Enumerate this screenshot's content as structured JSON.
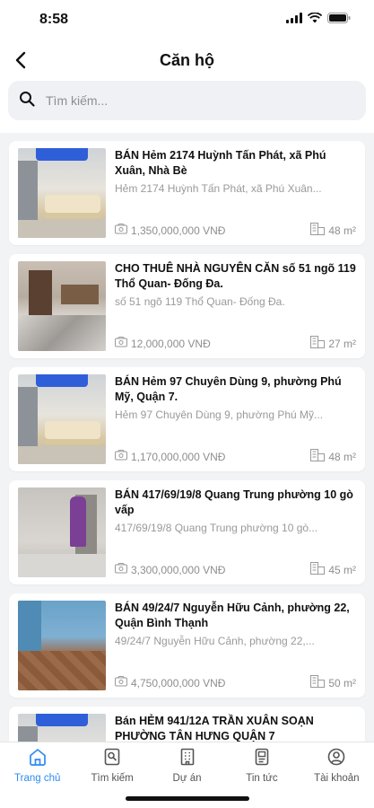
{
  "status_bar": {
    "time": "8:58"
  },
  "header": {
    "title": "Căn hộ"
  },
  "search": {
    "placeholder": "Tìm kiếm..."
  },
  "listings": [
    {
      "title": "BÁN Hẻm 2174 Huỳnh Tấn Phát, xã Phú Xuân, Nhà Bè",
      "address": "Hẻm 2174 Huỳnh Tấn Phát, xã Phú Xuân...",
      "price": "1,350,000,000 VNĐ",
      "area": "48 m²"
    },
    {
      "title": "CHO THUÊ NHÀ NGUYÊN CĂN số 51 ngõ 119 Thổ Quan- Đống Đa.",
      "address": "số 51 ngõ 119 Thổ Quan- Đống Đa.",
      "price": "12,000,000 VNĐ",
      "area": "27 m²"
    },
    {
      "title": "BÁN Hẻm 97 Chuyên Dùng 9, phường Phú Mỹ, Quận 7.",
      "address": "Hẻm 97 Chuyên Dùng 9, phường Phú Mỹ...",
      "price": "1,170,000,000 VNĐ",
      "area": "48 m²"
    },
    {
      "title": "BÁN 417/69/19/8 Quang Trung phường 10 gò vấp",
      "address": "417/69/19/8 Quang Trung phường 10 gò...",
      "price": "3,300,000,000 VNĐ",
      "area": "45 m²"
    },
    {
      "title": "BÁN 49/24/7 Nguyễn Hữu Cảnh, phường 22, Quận Bình Thạnh",
      "address": "49/24/7 Nguyễn Hữu Cảnh, phường 22,...",
      "price": "4,750,000,000 VNĐ",
      "area": "50 m²"
    },
    {
      "title": "Bán HẺM 941/12A TRẦN XUÂN SOẠN PHƯỜNG TÂN HƯNG QUẬN 7",
      "address": "",
      "price": "",
      "area": ""
    }
  ],
  "tabs": [
    {
      "label": "Trang chủ",
      "icon": "home-icon",
      "active": true
    },
    {
      "label": "Tìm kiếm",
      "icon": "search-doc-icon",
      "active": false
    },
    {
      "label": "Dự án",
      "icon": "building-icon",
      "active": false
    },
    {
      "label": "Tin tức",
      "icon": "news-icon",
      "active": false
    },
    {
      "label": "Tài khoản",
      "icon": "account-icon",
      "active": false
    }
  ],
  "colors": {
    "accent": "#2e8bf0",
    "background": "#f2f3f5"
  }
}
